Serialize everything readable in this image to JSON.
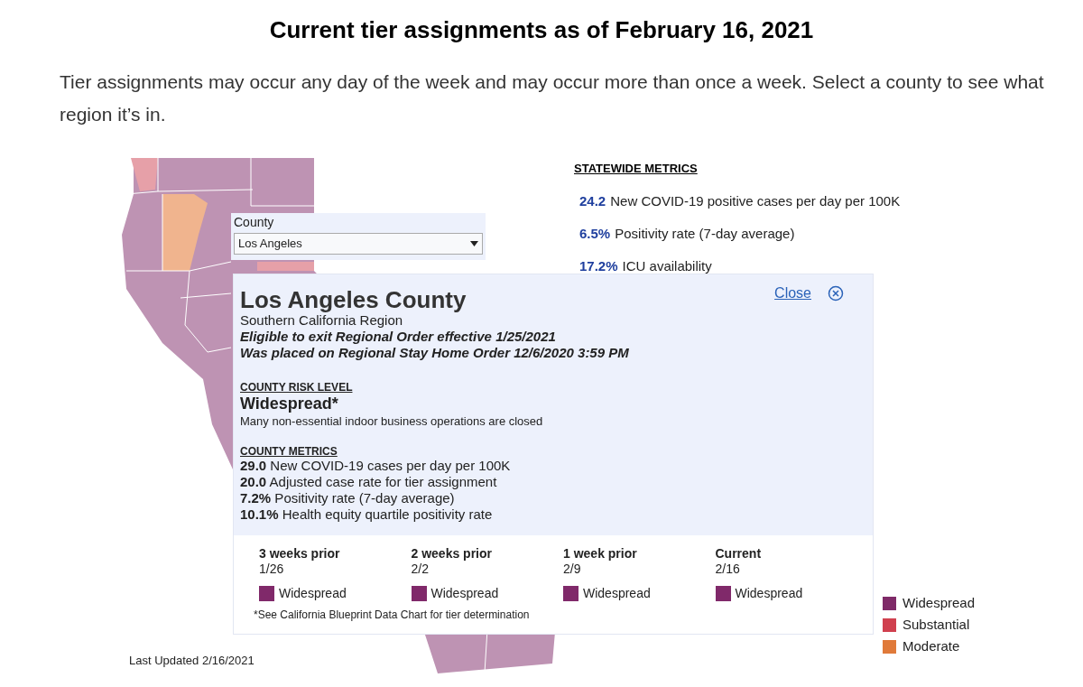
{
  "title": "Current tier assignments as of February 16, 2021",
  "intro": "Tier assignments may occur any day of the week and may occur more than once a week. Select a county to see what region it’s in.",
  "county_select": {
    "label": "County",
    "value": "Los Angeles"
  },
  "statewide_metrics": {
    "heading": "STATEWIDE METRICS",
    "items": [
      {
        "value": "24.2",
        "label": "New COVID-19 positive cases per day per 100K"
      },
      {
        "value": "6.5%",
        "label": "Positivity rate (7-day average)"
      },
      {
        "value": "17.2%",
        "label": "ICU availability"
      }
    ]
  },
  "county_popup": {
    "close_link": "Close",
    "title": "Los Angeles County",
    "region": "Southern California Region",
    "notes": [
      "Eligible to exit Regional Order effective 1/25/2021",
      "Was placed on Regional Stay Home Order 12/6/2020 3:59 PM"
    ],
    "risk_heading": "COUNTY RISK LEVEL",
    "risk_level": "Widespread*",
    "risk_description": "Many non-essential indoor business operations are closed",
    "metrics_heading": "COUNTY METRICS",
    "metrics": [
      "**29.0** New COVID-19 cases per day per 100K",
      "**20.0** Adjusted case rate for tier assignment",
      "**7.2%** Positivity rate (7-day average)",
      "**10.1%** Health equity quartile positivity rate"
    ],
    "history": [
      {
        "period": "3 weeks prior",
        "date": "1/26",
        "tier": "Widespread",
        "color": "#80296a"
      },
      {
        "period": "2 weeks prior",
        "date": "2/2",
        "tier": "Widespread",
        "color": "#80296a"
      },
      {
        "period": "1 week prior",
        "date": "2/9",
        "tier": "Widespread",
        "color": "#80296a"
      },
      {
        "period": "Current",
        "date": "2/16",
        "tier": "Widespread",
        "color": "#80296a"
      }
    ],
    "footnote": "*See California Blueprint Data Chart for tier determination"
  },
  "legend": [
    {
      "label": "Widespread",
      "color": "#7f2a68"
    },
    {
      "label": "Substantial",
      "color": "#d0404f"
    },
    {
      "label": "Moderate",
      "color": "#e07a3a"
    }
  ],
  "last_updated": "Last Updated 2/16/2021"
}
